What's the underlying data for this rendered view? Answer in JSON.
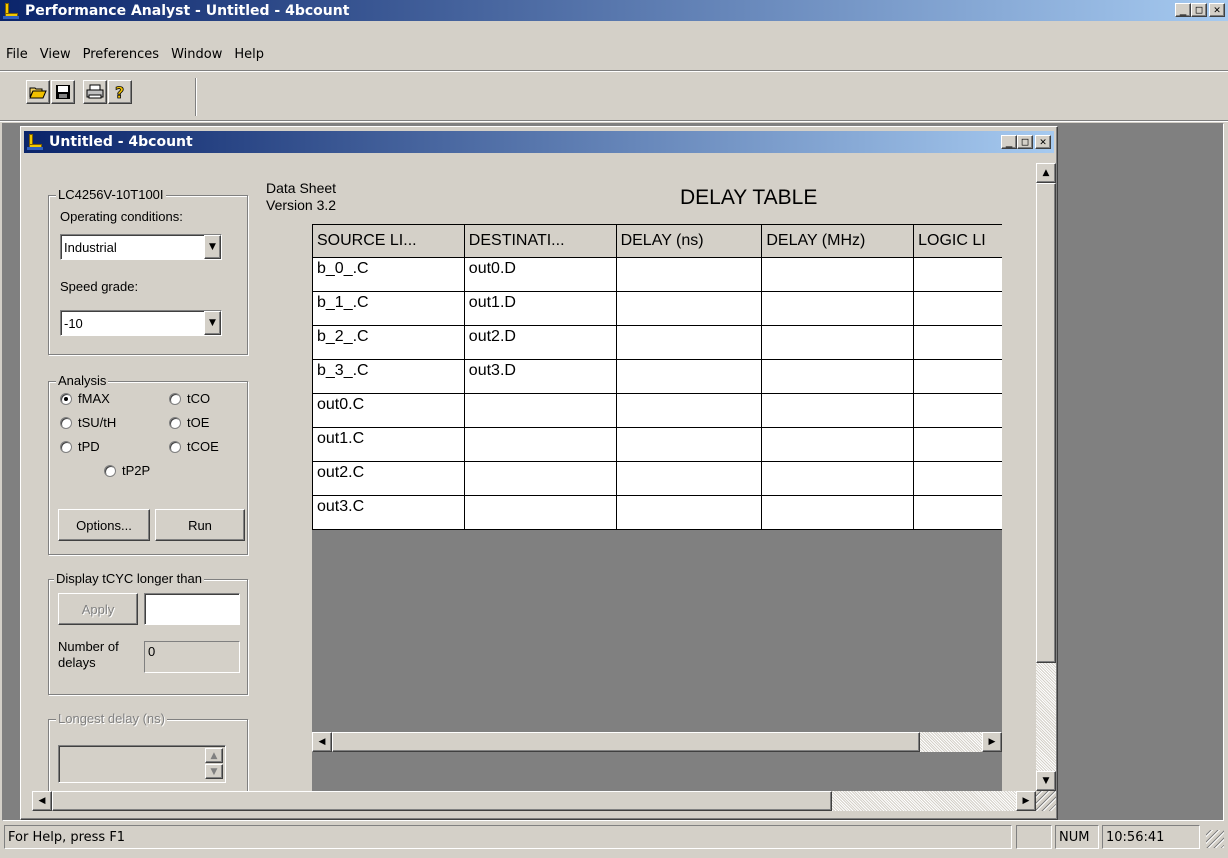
{
  "app": {
    "title": "Performance Analyst - Untitled - 4bcount",
    "menus": [
      "File",
      "View",
      "Preferences",
      "Window",
      "Help"
    ],
    "toolbar": [
      "open-icon",
      "save-icon",
      "print-icon",
      "help-icon"
    ]
  },
  "caption_buttons": {
    "minimize": "_",
    "maximize": "□",
    "close": "✕"
  },
  "child": {
    "title": "Untitled - 4bcount"
  },
  "device": {
    "group_label": "LC4256V-10T100I",
    "operating_label": "Operating conditions:",
    "operating_value": "Industrial",
    "speed_label": "Speed grade:",
    "speed_value": "-10"
  },
  "analysis": {
    "group_label": "Analysis",
    "options": [
      {
        "label": "fMAX",
        "selected": true
      },
      {
        "label": "tCO",
        "selected": false
      },
      {
        "label": "tSU/tH",
        "selected": false
      },
      {
        "label": "tOE",
        "selected": false
      },
      {
        "label": "tPD",
        "selected": false
      },
      {
        "label": "tCOE",
        "selected": false
      },
      {
        "label": "tP2P",
        "selected": false
      }
    ],
    "options_button": "Options...",
    "run_button": "Run"
  },
  "display": {
    "group_label": "Display tCYC longer than",
    "apply_button": "Apply",
    "apply_value": "",
    "delays_label_1": "Number of",
    "delays_label_2": "delays",
    "delays_value": "0"
  },
  "longest": {
    "group_label": "Longest delay (ns)",
    "value": ""
  },
  "sheet": {
    "line1": "Data Sheet",
    "line2": "Version 3.2",
    "title": "DELAY TABLE"
  },
  "table": {
    "headers": [
      "SOURCE LI...",
      "DESTINATI...",
      "DELAY (ns)",
      "DELAY (MHz)",
      "LOGIC LI"
    ],
    "rows": [
      [
        "b_0_.C",
        "out0.D",
        "",
        "",
        ""
      ],
      [
        "b_1_.C",
        "out1.D",
        "",
        "",
        ""
      ],
      [
        "b_2_.C",
        "out2.D",
        "",
        "",
        ""
      ],
      [
        "b_3_.C",
        "out3.D",
        "",
        "",
        ""
      ],
      [
        "out0.C",
        "",
        "",
        "",
        ""
      ],
      [
        "out1.C",
        "",
        "",
        "",
        ""
      ],
      [
        "out2.C",
        "",
        "",
        "",
        ""
      ],
      [
        "out3.C",
        "",
        "",
        "",
        ""
      ]
    ]
  },
  "status": {
    "help": "For Help, press F1",
    "num": "NUM",
    "time": "10:56:41"
  },
  "colors": {
    "face": "#d4d0c8",
    "title_active": "#0a246a",
    "title_gradient_end": "#a6caf0",
    "mdi_background": "#808080"
  }
}
